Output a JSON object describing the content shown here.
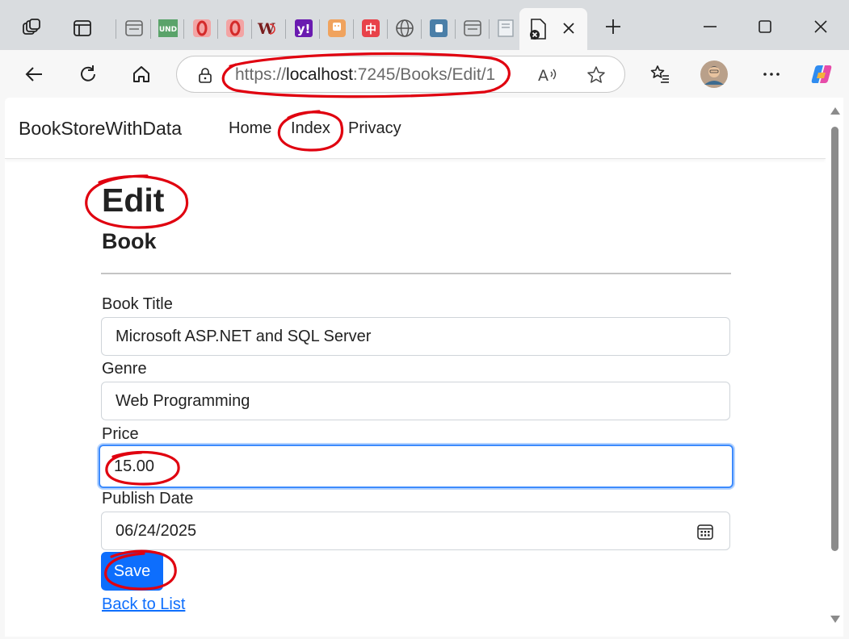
{
  "browser": {
    "url_scheme": "https://",
    "url_host": "localhost",
    "url_rest": ":7245/Books/Edit/1"
  },
  "site": {
    "brand": "BookStoreWithData",
    "nav": [
      "Home",
      "Index",
      "Privacy"
    ]
  },
  "page": {
    "title": "Edit",
    "subtitle": "Book"
  },
  "form": {
    "fields": [
      {
        "label": "Book Title",
        "value": "Microsoft ASP.NET and SQL Server"
      },
      {
        "label": "Genre",
        "value": "Web Programming"
      },
      {
        "label": "Price",
        "value": "15.00"
      },
      {
        "label": "Publish Date",
        "value": "06/24/2025"
      }
    ],
    "save_label": "Save",
    "back_label": "Back to List"
  },
  "colors": {
    "primary": "#0d6efd",
    "annotation": "#e0000f"
  },
  "tab_icons": [
    "workspaces-icon",
    "tab-actions-icon",
    "tab-icon",
    "und-icon",
    "opera-icon",
    "opera-icon",
    "wiki-icon",
    "yahoo-icon",
    "app-icon",
    "chinese-site-icon",
    "globe-icon",
    "app-icon",
    "tab-icon",
    "document-icon",
    "error-page-icon"
  ]
}
